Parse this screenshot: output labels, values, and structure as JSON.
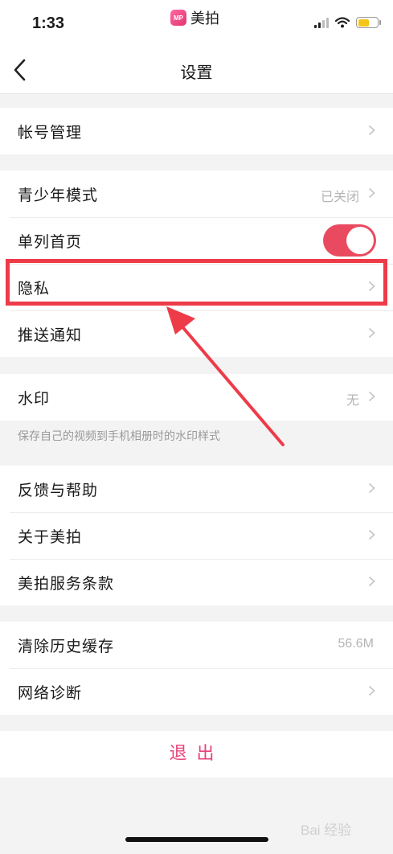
{
  "status_bar": {
    "time": "1:33",
    "app_logo": "MP",
    "app_name": "美拍",
    "battery_level": 0.6
  },
  "nav": {
    "title": "设置",
    "back_icon": "chevron-left-icon"
  },
  "groups": [
    {
      "rows": [
        {
          "label": "帐号管理",
          "value": ""
        }
      ]
    },
    {
      "rows": [
        {
          "label": "青少年模式",
          "value": "已关闭"
        },
        {
          "label": "单列首页",
          "toggle": true
        },
        {
          "label": "隐私",
          "value": ""
        },
        {
          "label": "推送通知",
          "value": ""
        }
      ]
    },
    {
      "rows": [
        {
          "label": "水印",
          "value": "无"
        }
      ],
      "note": "保存自己的视频到手机相册时的水印样式"
    },
    {
      "rows": [
        {
          "label": "反馈与帮助",
          "value": ""
        },
        {
          "label": "关于美拍",
          "value": ""
        },
        {
          "label": "美拍服务条款",
          "value": ""
        }
      ]
    },
    {
      "rows": [
        {
          "label": "清除历史缓存",
          "value": "56.6M"
        },
        {
          "label": "网络诊断",
          "value": ""
        }
      ]
    }
  ],
  "logout_label": "退出",
  "watermark": "Bai 经验",
  "colors": {
    "accent": "#e8427c",
    "toggle_on": "#ea4a60",
    "highlight": "#ee3b48"
  }
}
